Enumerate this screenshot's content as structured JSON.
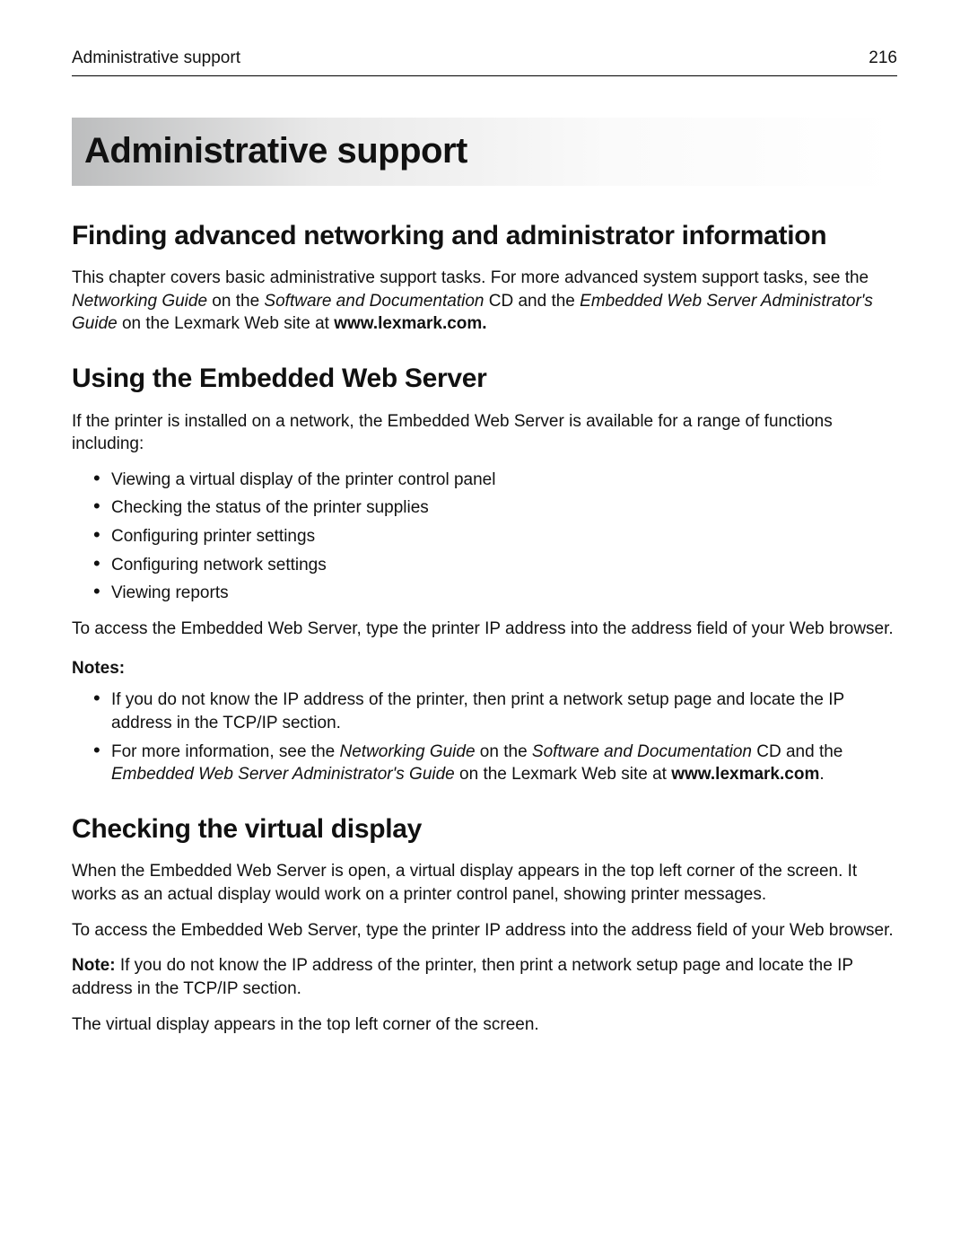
{
  "header": {
    "running_title": "Administrative support",
    "page_number": "216"
  },
  "title": "Administrative support",
  "s1": {
    "heading": "Finding advanced networking and administrator information",
    "p_a": "This chapter covers basic administrative support tasks. For more advanced system support tasks, see the ",
    "p_b_i": "Networking Guide",
    "p_c": " on the ",
    "p_d_i": "Software and Documentation",
    "p_e": " CD and the ",
    "p_f_i": "Embedded Web Server Administrator's Guide",
    "p_g": " on the Lexmark Web site at ",
    "p_h_b": "www.lexmark.com."
  },
  "s2": {
    "heading": "Using the Embedded Web Server",
    "intro": "If the printer is installed on a network, the Embedded Web Server is available for a range of functions including:",
    "bullets": {
      "0": "Viewing a virtual display of the printer control panel",
      "1": "Checking the status of the printer supplies",
      "2": "Configuring printer settings",
      "3": "Configuring network settings",
      "4": "Viewing reports"
    },
    "access": "To access the Embedded Web Server, type the printer IP address into the address field of your Web browser.",
    "notes_label": "Notes:",
    "note1": "If you do not know the IP address of the printer, then print a network setup page and locate the IP address in the TCP/IP section.",
    "note2_a": "For more information, see the ",
    "note2_b_i": "Networking Guide",
    "note2_c": " on the ",
    "note2_d_i": "Software and Documentation",
    "note2_e": " CD and the ",
    "note2_f_i": "Embedded Web Server Administrator's Guide",
    "note2_g": " on the Lexmark Web site at ",
    "note2_h_b": "www.lexmark.com",
    "note2_i": "."
  },
  "s3": {
    "heading": "Checking the virtual display",
    "p1": "When the Embedded Web Server is open, a virtual display appears in the top left corner of the screen. It works as an actual display would work on a printer control panel, showing printer messages.",
    "p2": "To access the Embedded Web Server, type the printer IP address into the address field of your Web browser.",
    "p3_a_b": "Note:",
    "p3_b": " If you do not know the IP address of the printer, then print a network setup page and locate the IP address in the TCP/IP section.",
    "p4": "The virtual display appears in the top left corner of the screen."
  }
}
